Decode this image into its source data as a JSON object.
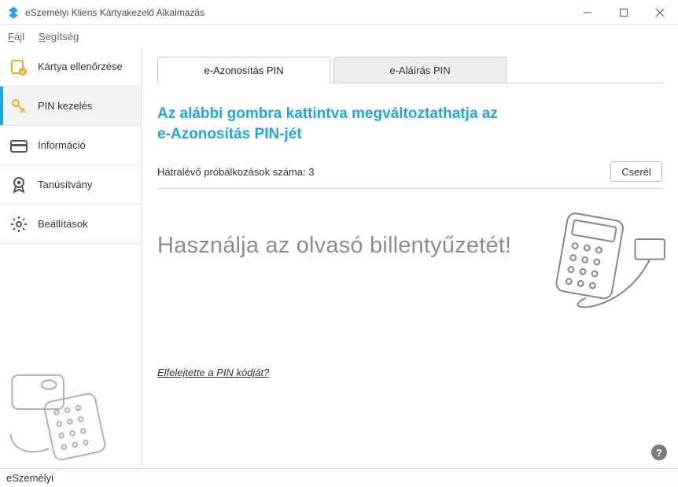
{
  "window": {
    "title": "eSzemélyi Kliens Kártyakezelő Alkalmazás"
  },
  "menu": {
    "file": "Fájl",
    "file_ul": "F",
    "file_rest": "ájl",
    "help": "Segítség",
    "help_ul": "S",
    "help_rest": "egítség"
  },
  "sidebar": [
    {
      "label": "Kártya ellenőrzése"
    },
    {
      "label": "PIN kezelés"
    },
    {
      "label": "Információ"
    },
    {
      "label": "Tanúsítvány"
    },
    {
      "label": "Beállítások"
    }
  ],
  "tabs": [
    {
      "label": "e-Azonosítás PIN",
      "active": true
    },
    {
      "label": "e-Aláírás PIN",
      "active": false
    }
  ],
  "content": {
    "heading_line1": "Az alábbi gombra kattintva megváltoztathatja az",
    "heading_line2": "e-Azonosítás PIN-jét",
    "attempts_label": "Hátralévő próbálkozások száma: 3",
    "change_button": "Cserél",
    "center_message": "Használja az olvasó billentyűzetét!",
    "forgot_link": "Elfelejtette a PIN kódját?",
    "help_symbol": "?"
  },
  "statusbar": {
    "text": "eSzemélyi"
  }
}
